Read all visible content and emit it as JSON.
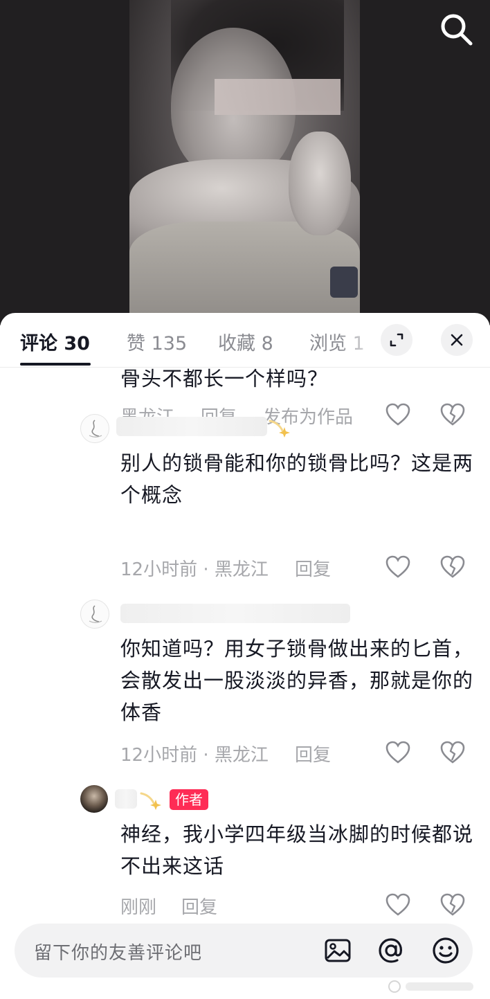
{
  "header": {
    "search_icon": "search-icon"
  },
  "tabs": [
    {
      "label": "评论 30",
      "active": true
    },
    {
      "label": "赞 135"
    },
    {
      "label": "收藏 8"
    },
    {
      "label": "浏览 1"
    }
  ],
  "sheet_controls": {
    "expand_icon": "expand-icon",
    "close_icon": "close-icon"
  },
  "comments": [
    {
      "text": "骨头不都长一个样吗？",
      "location": "黑龙江",
      "reply_label": "回复",
      "publish_label": "发布为作品"
    },
    {
      "text": "别人的锁骨能和你的锁骨比吗？这是两个概念",
      "time_location": "12小时前 · 黑龙江",
      "reply_label": "回复"
    },
    {
      "text": "你知道吗？用女子锁骨做出来的匕首，会散发出一股淡淡的异香，那就是你的体香",
      "time_location": "12小时前 · 黑龙江",
      "reply_label": "回复"
    },
    {
      "badge": "作者",
      "text": "神经，我小学四年级当冰脚的时候都说不出来这话",
      "time": "刚刚",
      "reply_label": "回复"
    }
  ],
  "input": {
    "placeholder": "留下你的友善评论吧",
    "icons": [
      "image-icon",
      "at-icon",
      "emoji-icon"
    ]
  },
  "colors": {
    "accent": "#fe2c55",
    "text": "#161823",
    "muted": "#a6a7ab"
  }
}
